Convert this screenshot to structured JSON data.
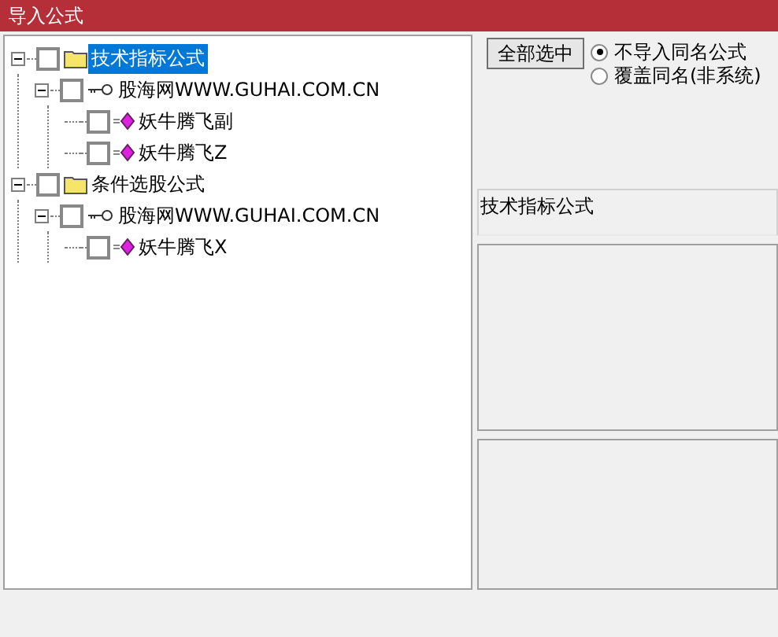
{
  "window": {
    "title": "导入公式"
  },
  "tree": [
    {
      "kind": "folder",
      "label": "技术指标公式",
      "selected": true,
      "checked": false,
      "expanded": true,
      "children": [
        {
          "kind": "group",
          "label": "股海网WWW.GUHAI.COM.CN",
          "selected": false,
          "checked": false,
          "expanded": true,
          "children": [
            {
              "kind": "formula",
              "label": "妖牛腾飞副",
              "selected": false,
              "checked": false
            },
            {
              "kind": "formula",
              "label": "妖牛腾飞Z",
              "selected": false,
              "checked": false
            }
          ]
        }
      ]
    },
    {
      "kind": "folder",
      "label": "条件选股公式",
      "selected": false,
      "checked": false,
      "expanded": true,
      "children": [
        {
          "kind": "group",
          "label": "股海网WWW.GUHAI.COM.CN",
          "selected": false,
          "checked": false,
          "expanded": true,
          "children": [
            {
              "kind": "formula",
              "label": "妖牛腾飞X",
              "selected": false,
              "checked": false
            }
          ]
        }
      ]
    }
  ],
  "select_all_button": "全部选中",
  "options": [
    {
      "label": "不导入同名公式",
      "selected": true
    },
    {
      "label": "覆盖同名(非系统)",
      "selected": false
    }
  ],
  "info_field": "技术指标公式"
}
